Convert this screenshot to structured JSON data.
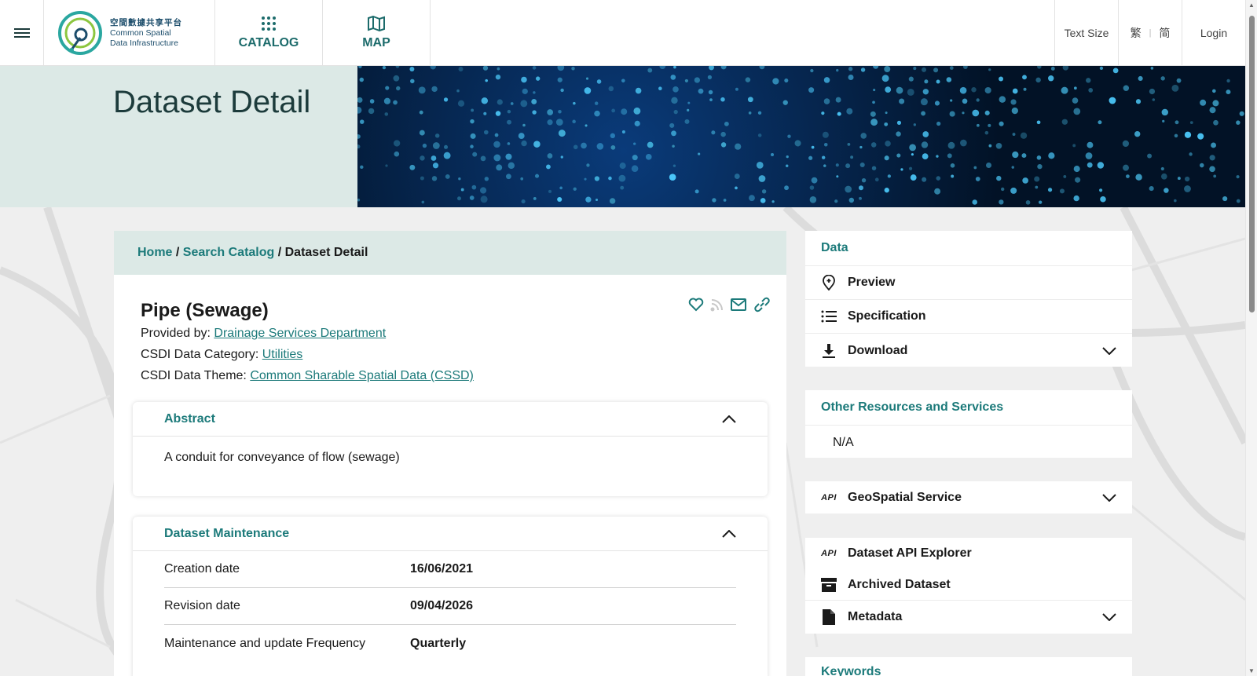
{
  "header": {
    "logo_cn": "空間數據共享平台",
    "logo_en_1": "Common Spatial",
    "logo_en_2": "Data Infrastructure",
    "nav": {
      "catalog": "CATALOG",
      "map": "MAP"
    },
    "text_size": "Text Size",
    "lang_trad": "繁",
    "lang_simp": "简",
    "login": "Login"
  },
  "banner": {
    "title": "Dataset Detail"
  },
  "breadcrumb": {
    "home": "Home",
    "sep1": " / ",
    "search": "Search Catalog",
    "sep2": " / ",
    "current": "Dataset Detail"
  },
  "dataset": {
    "title": "Pipe (Sewage)",
    "provided_label": "Provided by: ",
    "provider": "Drainage Services Department",
    "category_label": "CSDI Data Category: ",
    "category": "Utilities",
    "theme_label": "CSDI Data Theme: ",
    "theme": "Common Sharable Spatial Data (CSSD)"
  },
  "abstract": {
    "heading": "Abstract",
    "text": "A conduit for conveyance of flow (sewage)"
  },
  "maintenance": {
    "heading": "Dataset Maintenance",
    "rows": [
      {
        "label": "Creation date",
        "value": "16/06/2021"
      },
      {
        "label": "Revision date",
        "value": "09/04/2026"
      },
      {
        "label": "Maintenance and update Frequency",
        "value": "Quarterly"
      }
    ]
  },
  "side": {
    "data_heading": "Data",
    "preview": "Preview",
    "specification": "Specification",
    "download": "Download",
    "other_heading": "Other Resources and Services",
    "other_value": "N/A",
    "geospatial": "GeoSpatial Service",
    "api_explorer": "Dataset API Explorer",
    "archived": "Archived Dataset",
    "metadata": "Metadata",
    "keywords_heading": "Keywords",
    "api_badge": "API"
  },
  "colors": {
    "accent": "#1c7a7a",
    "banner_bg": "#dce9e6"
  }
}
